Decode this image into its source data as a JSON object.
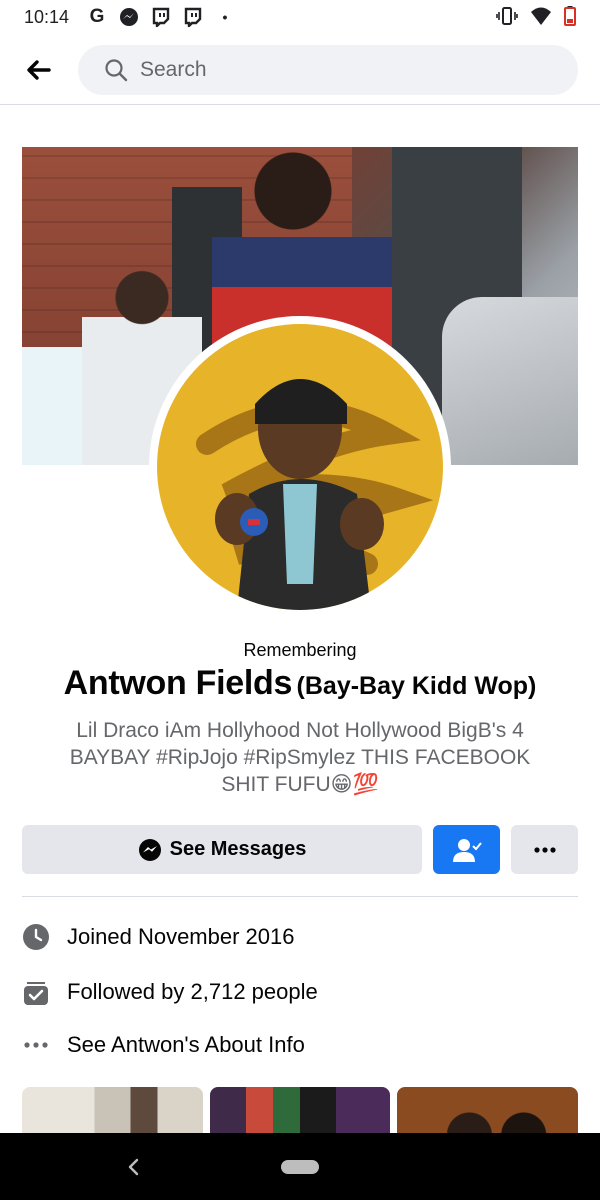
{
  "status_bar": {
    "time": "10:14",
    "left_icons": [
      "google-icon",
      "messenger-icon",
      "twitch-icon",
      "twitch-icon",
      "dot-icon"
    ],
    "right_icons": [
      "vibrate-icon",
      "wifi-icon",
      "battery-low-icon"
    ],
    "google_glyph": "G",
    "dot_glyph": "•"
  },
  "top_bar": {
    "search_placeholder": "Search"
  },
  "profile": {
    "remembering": "Remembering",
    "name": "Antwon Fields",
    "alt_name": "(Bay-Bay Kidd Wop)",
    "bio": "Lil Draco iAm Hollyhood Not Hollywood BigB's 4 BAYBAY #RipJojo #RipSmylez THIS FACEBOOK SHIT FUFU😁💯"
  },
  "actions": {
    "messages_label": "See Messages",
    "friends_icon": "friends-check-icon",
    "more_icon": "more-icon"
  },
  "info": {
    "joined": "Joined November 2016",
    "followers": "Followed by 2,712 people",
    "about": "See Antwon's About Info"
  },
  "colors": {
    "accent": "#1877f2",
    "button_gray": "#e4e6eb",
    "secondary_text": "#65676b",
    "avatar_bg": "#e7b429"
  }
}
